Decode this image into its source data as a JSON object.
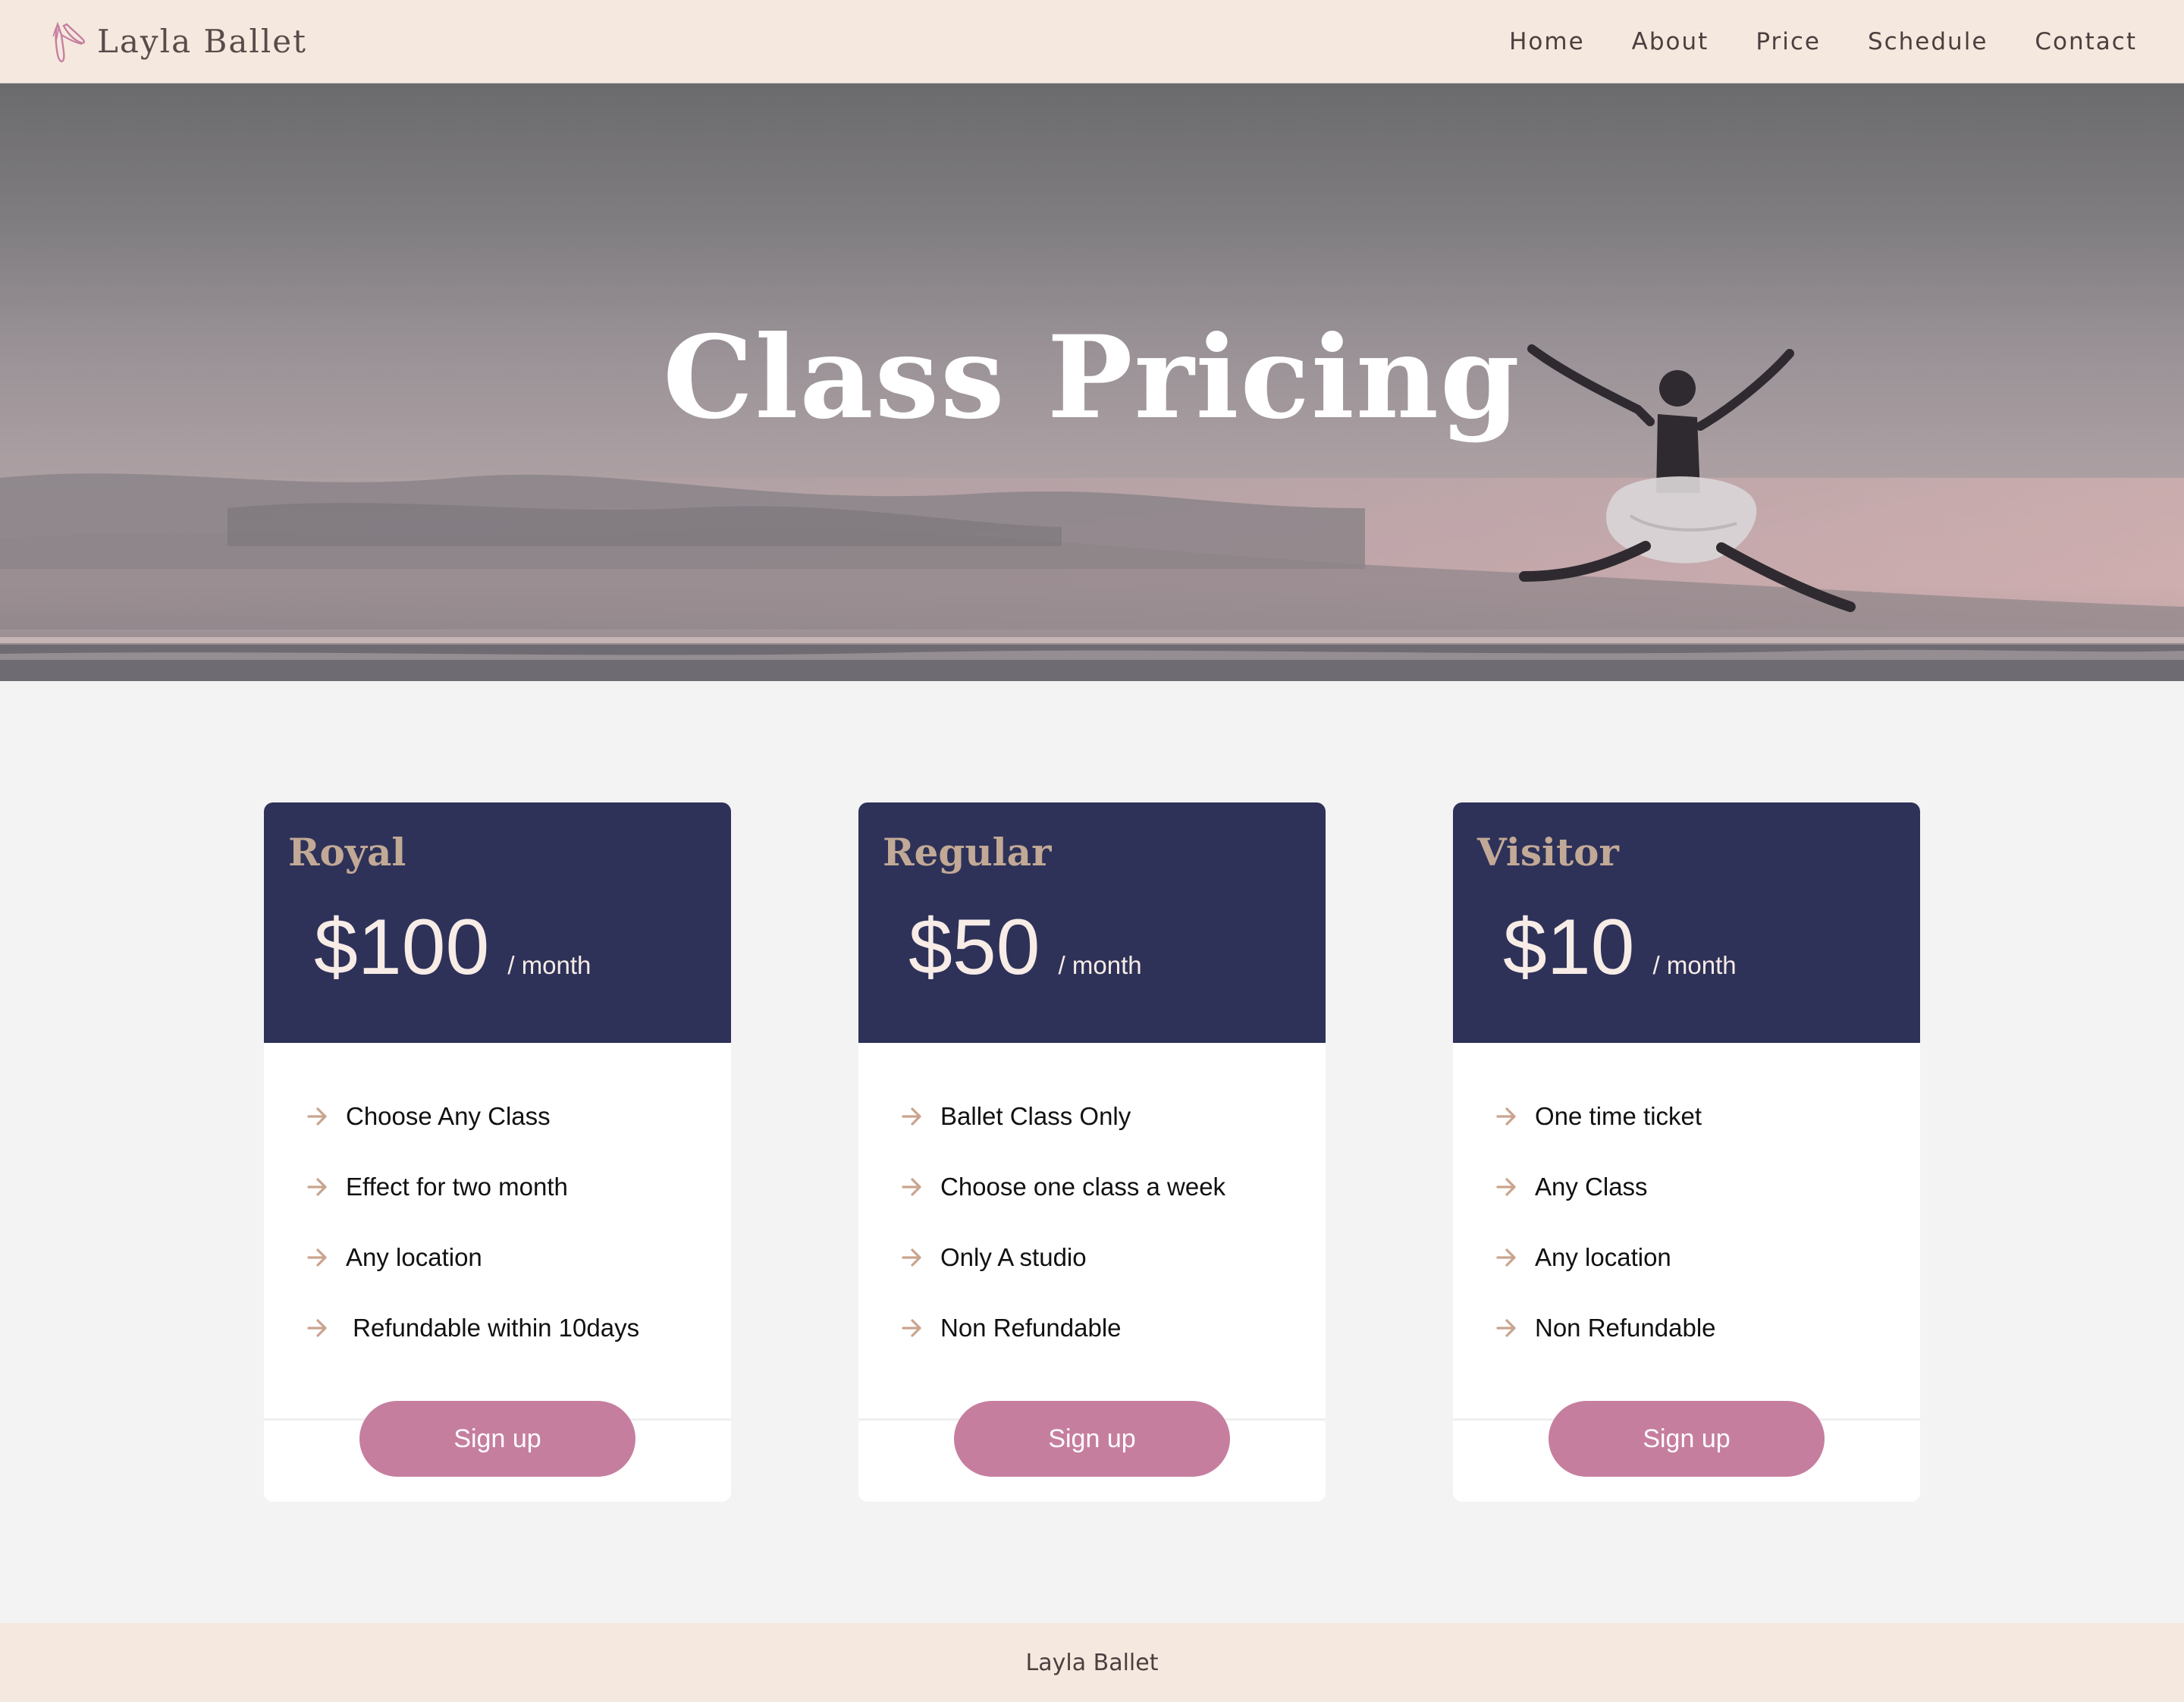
{
  "header": {
    "brand": "Layla Ballet",
    "logo_icon": "ballet-shoes-icon",
    "nav": [
      "Home",
      "About",
      "Price",
      "Schedule",
      "Contact"
    ]
  },
  "hero": {
    "title": "Class Pricing"
  },
  "plans": [
    {
      "name": "Royal",
      "price": "$100",
      "period": "/ month",
      "features": [
        "Choose Any Class",
        "Effect for two month",
        "Any location",
        " Refundable within 10days"
      ],
      "button": "Sign up"
    },
    {
      "name": "Regular",
      "price": "$50",
      "period": "/ month",
      "features": [
        "Ballet Class Only",
        "Choose one class a week",
        "Only A studio",
        "Non Refundable"
      ],
      "button": "Sign up"
    },
    {
      "name": "Visitor",
      "price": "$10",
      "period": "/ month",
      "features": [
        "One time ticket",
        "Any Class",
        "Any location",
        "Non Refundable"
      ],
      "button": "Sign up"
    }
  ],
  "footer": {
    "text": "Layla Ballet"
  },
  "colors": {
    "header_bg": "#f5e9df",
    "card_head": "#2e3259",
    "plan_name": "#c2a996",
    "button": "#c67e9f",
    "arrow": "#c9a48e",
    "page_bg": "#f3f3f3"
  }
}
